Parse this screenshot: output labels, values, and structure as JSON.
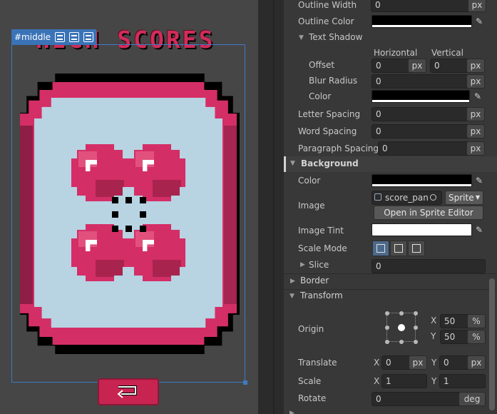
{
  "viewport": {
    "title_text": "HIGH SCORES",
    "selection_tag": "#middle"
  },
  "inspector": {
    "outline_width_label": "Outline Width",
    "outline_width_value": "0",
    "outline_width_unit": "px",
    "outline_color_label": "Outline Color",
    "text_shadow_label": "Text Shadow",
    "horizontal_header": "Horizontal",
    "vertical_header": "Vertical",
    "offset_label": "Offset",
    "offset_h_value": "0",
    "offset_h_unit": "px",
    "offset_v_value": "0",
    "offset_v_unit": "px",
    "blur_label": "Blur Radius",
    "blur_value": "0",
    "blur_unit": "px",
    "shadow_color_label": "Color",
    "letter_spacing_label": "Letter Spacing",
    "letter_spacing_value": "0",
    "letter_spacing_unit": "px",
    "word_spacing_label": "Word Spacing",
    "word_spacing_value": "0",
    "word_spacing_unit": "px",
    "paragraph_spacing_label": "Paragraph Spacing",
    "paragraph_spacing_value": "0",
    "paragraph_spacing_unit": "px",
    "background_section": "Background",
    "bg_color_label": "Color",
    "image_label": "Image",
    "image_value": "score_pan",
    "image_type": "Sprite",
    "open_sprite_editor": "Open in Sprite Editor",
    "image_tint_label": "Image Tint",
    "scale_mode_label": "Scale Mode",
    "slice_label": "Slice",
    "slice_value": "0",
    "border_section": "Border",
    "transform_section": "Transform",
    "origin_label": "Origin",
    "origin_x_label": "X",
    "origin_x_value": "50",
    "origin_x_unit": "%",
    "origin_y_label": "Y",
    "origin_y_value": "50",
    "origin_y_unit": "%",
    "translate_label": "Translate",
    "translate_x_label": "X",
    "translate_x_value": "0",
    "translate_x_unit": "px",
    "translate_y_label": "Y",
    "translate_y_value": "0",
    "translate_y_unit": "px",
    "scale_label": "Scale",
    "scale_x_label": "X",
    "scale_x_value": "1",
    "scale_y_label": "Y",
    "scale_y_value": "1",
    "rotate_label": "Rotate",
    "rotate_value": "0",
    "rotate_unit": "deg"
  },
  "colors": {
    "outline_color": "#000000",
    "shadow_color": "#000000",
    "bg_color": "#000000",
    "image_tint": "#ffffff",
    "accent_blue": "#3a73b7",
    "panel_pink": "#d42e66",
    "panel_inner": "#b8d3e2"
  },
  "icons": {
    "color_picker": "eyedropper-icon",
    "section_expand": "triangle-down-icon",
    "section_collapsed": "triangle-right-icon",
    "object_field": "target-icon",
    "back_button": "return-arrow-icon"
  }
}
